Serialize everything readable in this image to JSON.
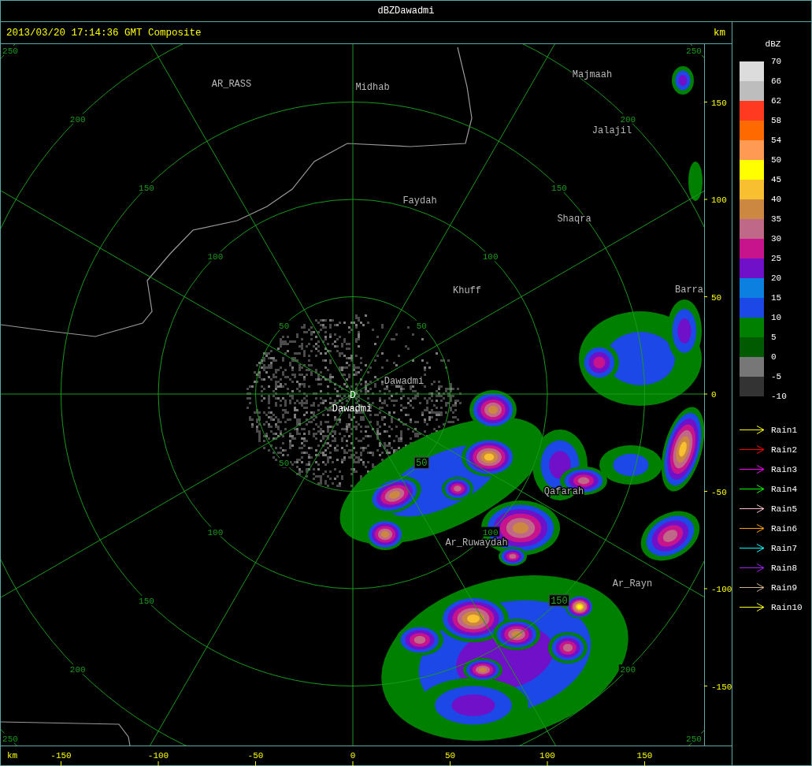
{
  "window": {
    "title": "dBZDawadmi"
  },
  "header": {
    "timestamp": "2013/03/20 17:14:36 GMT Composite",
    "unit": "km"
  },
  "map": {
    "radar_site": {
      "marker": "D",
      "name": "Dawadmi"
    },
    "places": [
      {
        "name": "AR_RASS"
      },
      {
        "name": "Midhab"
      },
      {
        "name": "Majmaah"
      },
      {
        "name": "Jalajil"
      },
      {
        "name": "Faydah"
      },
      {
        "name": "Shaqra"
      },
      {
        "name": "Khuff"
      },
      {
        "name": "Barra"
      },
      {
        "name": "Dawadmi"
      },
      {
        "name": "Qafarah"
      },
      {
        "name": "Ar_Ruwaydah"
      },
      {
        "name": "Ar_Rayn"
      }
    ],
    "range_rings": [
      {
        "labels": [
          {
            "text": "50",
            "boxed": false
          },
          {
            "text": "50",
            "boxed": false
          },
          {
            "text": "50",
            "boxed": false
          },
          {
            "text": "50",
            "boxed": true
          }
        ]
      },
      {
        "labels": [
          {
            "text": "100",
            "boxed": false
          },
          {
            "text": "100",
            "boxed": false
          },
          {
            "text": "100",
            "boxed": false
          },
          {
            "text": "100",
            "boxed": false
          }
        ]
      },
      {
        "labels": [
          {
            "text": "150",
            "boxed": false
          },
          {
            "text": "150",
            "boxed": false
          },
          {
            "text": "150",
            "boxed": false
          },
          {
            "text": "150",
            "boxed": true
          }
        ]
      },
      {
        "labels": [
          {
            "text": "200",
            "boxed": false
          },
          {
            "text": "200",
            "boxed": false
          },
          {
            "text": "200",
            "boxed": false
          },
          {
            "text": "200",
            "boxed": false
          }
        ]
      },
      {
        "labels": [
          {
            "text": "250",
            "boxed": false
          },
          {
            "text": "250",
            "boxed": false
          },
          {
            "text": "250",
            "boxed": false
          },
          {
            "text": "250",
            "boxed": false
          }
        ]
      }
    ],
    "y_axis": {
      "ticks": [
        "150",
        "100",
        "50",
        "0",
        "-50",
        "-100",
        "-150"
      ]
    },
    "x_axis": {
      "unit": "km",
      "ticks": [
        "-150",
        "-100",
        "-50",
        "0",
        "50",
        "100",
        "150"
      ]
    }
  },
  "legend": {
    "title": "dBZ",
    "bands": [
      {
        "color": "#dcdcdc"
      },
      {
        "color": "#bdbdbd"
      },
      {
        "color": "#ff3a20"
      },
      {
        "color": "#ff6a00"
      },
      {
        "color": "#ff9a55"
      },
      {
        "color": "#ffff00"
      },
      {
        "color": "#f8c030"
      },
      {
        "color": "#cc8840"
      },
      {
        "color": "#c06888"
      },
      {
        "color": "#c8148c"
      },
      {
        "color": "#7010c8"
      },
      {
        "color": "#0c80e0"
      },
      {
        "color": "#1c48e8"
      },
      {
        "color": "#008000"
      },
      {
        "color": "#005a00"
      },
      {
        "color": "#777777"
      },
      {
        "color": "#333333"
      }
    ],
    "labels": [
      "70",
      "66",
      "62",
      "58",
      "54",
      "50",
      "45",
      "40",
      "35",
      "30",
      "25",
      "20",
      "15",
      "10",
      "5",
      "0",
      "-5",
      "-10"
    ],
    "rain": [
      {
        "label": "Rain1",
        "color": "#ffff00"
      },
      {
        "label": "Rain2",
        "color": "#ff0000"
      },
      {
        "label": "Rain3",
        "color": "#ff00ff"
      },
      {
        "label": "Rain4",
        "color": "#00ff00"
      },
      {
        "label": "Rain5",
        "color": "#ffc0c8"
      },
      {
        "label": "Rain6",
        "color": "#ffa000"
      },
      {
        "label": "Rain7",
        "color": "#00ffff"
      },
      {
        "label": "Rain8",
        "color": "#a020f0"
      },
      {
        "label": "Rain9",
        "color": "#d2b48c"
      },
      {
        "label": "Rain10",
        "color": "#ffff00"
      }
    ]
  }
}
